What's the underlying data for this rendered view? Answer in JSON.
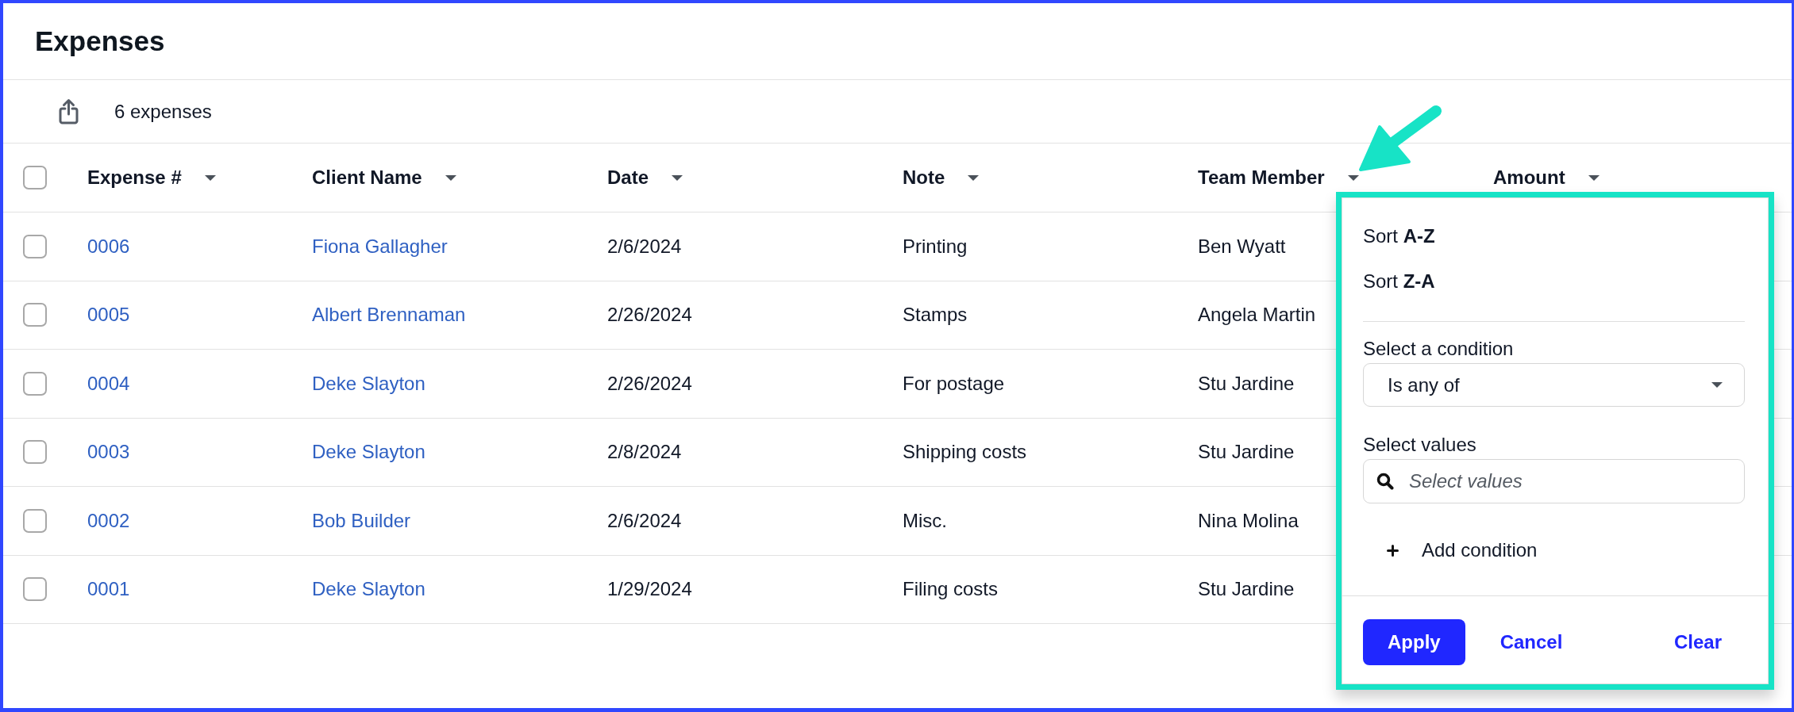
{
  "page": {
    "title": "Expenses"
  },
  "toolbar": {
    "count": "6 expenses"
  },
  "table": {
    "select_all": {
      "checked": false
    },
    "columns": [
      "Expense #",
      "Client Name",
      "Date",
      "Note",
      "Team Member",
      "Amount"
    ],
    "rows": [
      {
        "checked": false,
        "expense_no": "0006",
        "client_name": "Fiona Gallagher",
        "date": "2/6/2024",
        "note": "Printing",
        "team_member": "Ben Wyatt"
      },
      {
        "checked": false,
        "expense_no": "0005",
        "client_name": "Albert Brennaman",
        "date": "2/26/2024",
        "note": "Stamps",
        "team_member": "Angela Martin"
      },
      {
        "checked": false,
        "expense_no": "0004",
        "client_name": "Deke Slayton",
        "date": "2/26/2024",
        "note": "For postage",
        "team_member": "Stu Jardine"
      },
      {
        "checked": false,
        "expense_no": "0003",
        "client_name": "Deke Slayton",
        "date": "2/8/2024",
        "note": "Shipping costs",
        "team_member": "Stu Jardine"
      },
      {
        "checked": false,
        "expense_no": "0002",
        "client_name": "Bob Builder",
        "date": "2/6/2024",
        "note": "Misc.",
        "team_member": "Nina Molina"
      },
      {
        "checked": false,
        "expense_no": "0001",
        "client_name": "Deke Slayton",
        "date": "1/29/2024",
        "note": "Filing costs",
        "team_member": "Stu Jardine"
      }
    ]
  },
  "filter_menu": {
    "sort_options": [
      "Sort **A-Z**",
      "Sort **Z-A**"
    ],
    "condition_label": "Select a condition",
    "condition": {
      "value": "Is any of"
    },
    "values_label": "Select values",
    "values_search": {
      "placeholder": "Select values"
    },
    "add_condition": "Add condition",
    "buttons": [
      {
        "label": "Apply",
        "kind": "primary"
      },
      {
        "label": "Cancel",
        "kind": "link"
      },
      {
        "label": "Clear",
        "kind": "link"
      }
    ]
  }
}
